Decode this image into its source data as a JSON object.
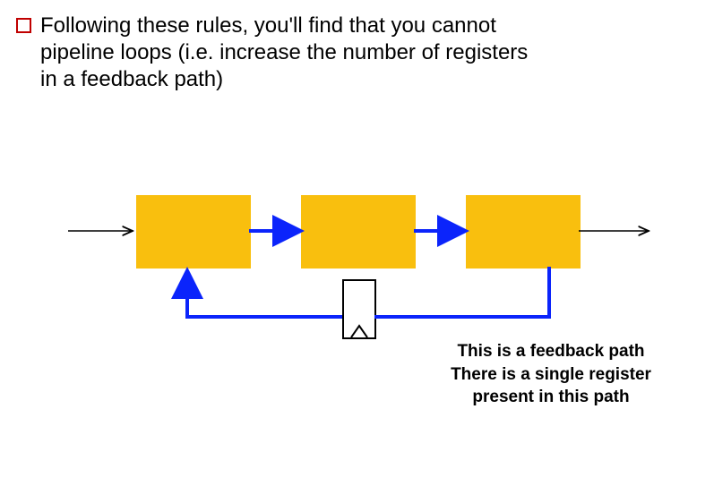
{
  "bullet": {
    "text": "Following these rules, you'll find that you cannot pipeline loops (i.e. increase the number of registers in a feedback path)"
  },
  "annotation": {
    "line1": "This is a feedback path",
    "line2": "There is a single register",
    "line3": "present in this path"
  },
  "colors": {
    "block": "#f9bf0e",
    "wire_blue": "#0b24fb",
    "bullet_border": "#c00000"
  },
  "chart_data": {
    "type": "diagram",
    "description": "Pipeline feedback loop diagram",
    "blocks": [
      {
        "id": "b1",
        "type": "processing-block"
      },
      {
        "id": "b2",
        "type": "processing-block"
      },
      {
        "id": "b3",
        "type": "processing-block"
      }
    ],
    "register": {
      "between": [
        "b3",
        "b1"
      ],
      "count": 1
    },
    "forward_path": [
      "input",
      "b1",
      "b2",
      "b3",
      "output"
    ],
    "feedback_path": [
      "b3",
      "register",
      "b1"
    ]
  }
}
